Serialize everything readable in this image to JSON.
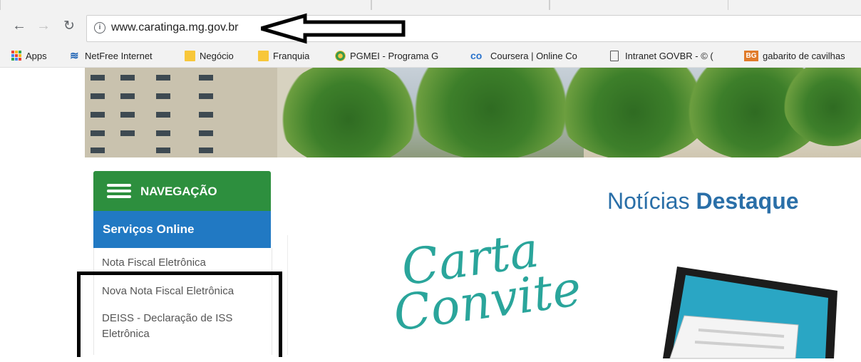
{
  "browser": {
    "url": "www.caratinga.mg.gov.br",
    "bookmarks": [
      {
        "label": "Apps",
        "icon": "apps-grid-icon"
      },
      {
        "label": "NetFree Internet",
        "icon": "netfree-icon"
      },
      {
        "label": "Negócio",
        "icon": "folder-icon"
      },
      {
        "label": "Franquia",
        "icon": "folder-icon"
      },
      {
        "label": "PGMEI - Programa G",
        "icon": "pgmei-icon"
      },
      {
        "label": "Coursera | Online Co",
        "icon": "coursera-icon"
      },
      {
        "label": "Intranet GOVBR - © (",
        "icon": "page-icon"
      },
      {
        "label": "gabarito de cavilhas",
        "icon": "bg-icon"
      }
    ]
  },
  "sidebar": {
    "nav_title": "NAVEGAÇÃO",
    "section_title": "Serviços Online",
    "items": [
      "Nota Fiscal Eletrônica",
      "Nova Nota Fiscal Eletrônica",
      "DEISS - Declaração de ISS Eletrônica"
    ]
  },
  "main": {
    "heading_light": "Notícias",
    "heading_bold": "Destaque",
    "feature_text_line1": "Carta",
    "feature_text_line2": "Convite"
  },
  "colors": {
    "nav_green": "#2d8f3e",
    "services_blue": "#2179c3",
    "heading_blue": "#2a6fa8",
    "carta_teal": "#2aa59b"
  }
}
